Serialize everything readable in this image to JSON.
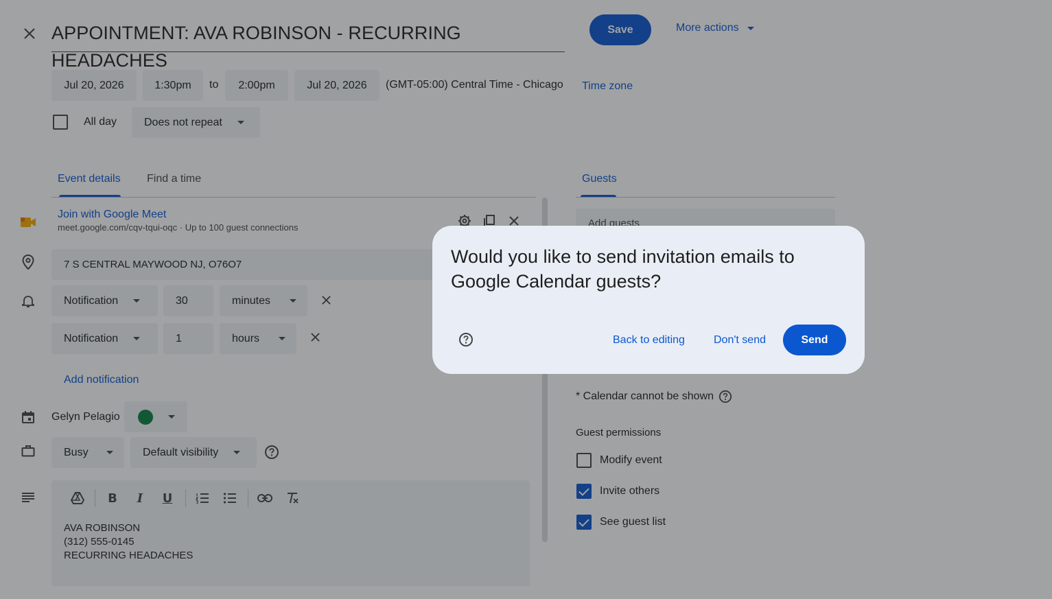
{
  "event": {
    "title": "APPOINTMENT: AVA ROBINSON - RECURRING HEADACHES",
    "start_date": "Jul 20, 2026",
    "start_time": "1:30pm",
    "to": "to",
    "end_time": "2:00pm",
    "end_date": "Jul 20, 2026",
    "timezone": "(GMT-05:00) Central Time - Chicago",
    "timezone_link": "Time zone",
    "all_day": "All day",
    "repeat": "Does not repeat"
  },
  "header": {
    "save": "Save",
    "more_actions": "More actions"
  },
  "tabs": {
    "event_details": "Event details",
    "find_time": "Find a time",
    "guests": "Guests"
  },
  "meet": {
    "join": "Join with Google Meet",
    "info": "meet.google.com/cqv-tqui-oqc · Up to 100 guest connections"
  },
  "location": "7 S CENTRAL MAYWOOD NJ, O76O7",
  "notifications": [
    {
      "type": "Notification",
      "amount": "30",
      "unit": "minutes"
    },
    {
      "type": "Notification",
      "amount": "1",
      "unit": "hours"
    }
  ],
  "add_notification": "Add notification",
  "calendar": {
    "owner": "Gelyn Pelagio",
    "color": "#0b8043"
  },
  "availability": "Busy",
  "visibility": "Default visibility",
  "description": {
    "line1": "AVA ROBINSON",
    "line2": "(312) 555-0145",
    "line3": "RECURRING HEADACHES"
  },
  "guests": {
    "add_placeholder": "Add guests",
    "calendar_note": "* Calendar cannot be shown",
    "permissions_title": "Guest permissions",
    "permissions": [
      {
        "label": "Modify event",
        "checked": false
      },
      {
        "label": "Invite others",
        "checked": true
      },
      {
        "label": "See guest list",
        "checked": true
      }
    ]
  },
  "dialog": {
    "message": "Would you like to send invitation emails to Google Calendar guests?",
    "back": "Back to editing",
    "dont_send": "Don't send",
    "send": "Send"
  },
  "colors": {
    "accent": "#0b57d0",
    "field_bg": "#f0f4f9",
    "dialog_bg": "#e9eef6",
    "meet_yellow": "#f9ab00"
  }
}
